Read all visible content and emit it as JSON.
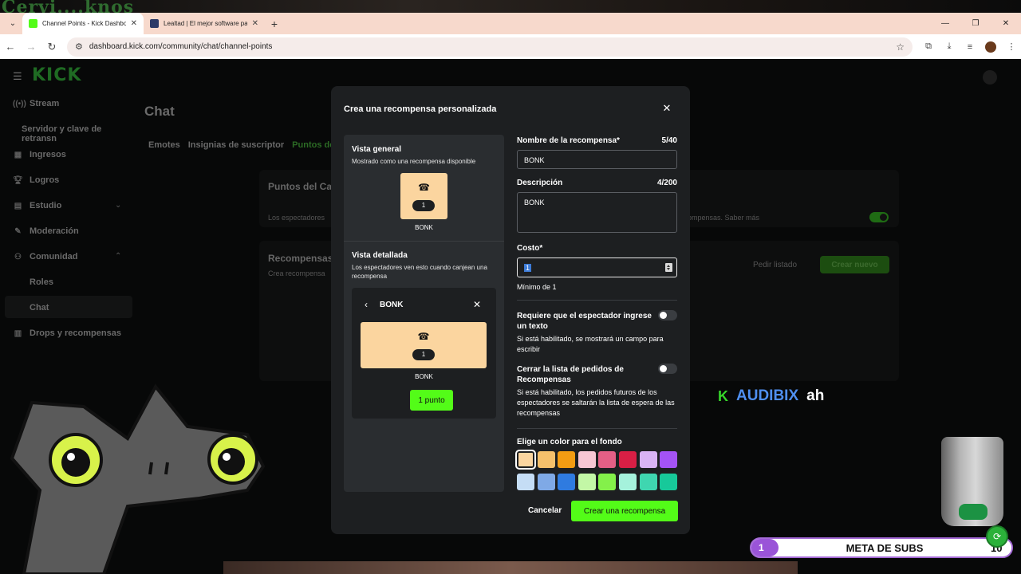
{
  "stream_top_text": "Cervi....knos",
  "browser": {
    "tabs": [
      {
        "title": "Channel Points - Kick Dashboard",
        "favicon_color": "#53fc18",
        "active": true
      },
      {
        "title": "Lealtad | El mejor software para",
        "favicon_color": "#2b3a67",
        "active": false
      }
    ],
    "url": "dashboard.kick.com/community/chat/channel-points"
  },
  "sidebar": {
    "logo": "KICK",
    "items": [
      {
        "label": "Stream",
        "icon": "broadcast-icon"
      },
      {
        "label": "Servidor y clave de retransn",
        "icon": ""
      },
      {
        "label": "Ingresos",
        "icon": "revenue-icon"
      },
      {
        "label": "Logros",
        "icon": "trophy-icon"
      },
      {
        "label": "Estudio",
        "icon": "studio-icon"
      },
      {
        "label": "Moderación",
        "icon": "wrench-icon"
      },
      {
        "label": "Comunidad",
        "icon": "community-icon"
      },
      {
        "label": "Roles",
        "icon": ""
      },
      {
        "label": "Chat",
        "icon": ""
      },
      {
        "label": "Drops y recompensas",
        "icon": "drops-icon"
      }
    ]
  },
  "main": {
    "title": "Chat",
    "tabs": [
      "Emotes",
      "Insignias de suscriptor",
      "Puntos de"
    ],
    "card1_title": "Puntos del Ca",
    "card1_text_left": "Los espectadores",
    "card1_text_right": "ompensas. Saber más",
    "card2_title": "Recompensas",
    "card2_sub": "Crea recompensa",
    "pedir_listado": "Pedir listado",
    "crear_nuevo": "Crear nuevo"
  },
  "modal": {
    "title": "Crea una recompensa personalizada",
    "preview": {
      "general_title": "Vista general",
      "general_sub": "Mostrado como una recompensa disponible",
      "reward_name": "BONK",
      "reward_cost": "1",
      "detailed_title": "Vista detallada",
      "detailed_sub": "Los espectadores ven esto cuando canjean una recompensa",
      "detail_header": "BONK",
      "point_button": "1 punto"
    },
    "form": {
      "name_label": "Nombre de la recompensa*",
      "name_count": "5/40",
      "name_value": "BONK",
      "desc_label": "Descripción",
      "desc_count": "4/200",
      "desc_value": "BONK",
      "cost_label": "Costo*",
      "cost_value": "1",
      "cost_help": "Mínimo de 1",
      "require_text_label": "Requiere que el espectador ingrese un texto",
      "require_text_help": "Si está habilitado, se mostrará un campo para escribir",
      "close_queue_label": "Cerrar la lista de pedidos de Recompensas",
      "close_queue_help": "Si está habilitado, los pedidos futuros de los espectadores se saltarán la lista de espera de las recompensas",
      "color_label": "Elige un color para el fondo",
      "colors": [
        "#fbd59f",
        "#f5c06b",
        "#f39c12",
        "#f7c6d4",
        "#e45f86",
        "#d81f45",
        "#d9b3f5",
        "#a453f5",
        "#c5ddf5",
        "#7fa9e6",
        "#2f7be0",
        "#c3f7a6",
        "#84f04a",
        "#a5f2dc",
        "#3fd6b0",
        "#17c99a"
      ],
      "selected_color_index": 0,
      "cancel": "Cancelar",
      "create": "Crear una recompensa"
    }
  },
  "overlay": {
    "chat_user": "AUDIBIX",
    "chat_msg": "ah",
    "subgoal_label": "META DE SUBS",
    "subgoal_current": "1",
    "subgoal_target": "10"
  }
}
